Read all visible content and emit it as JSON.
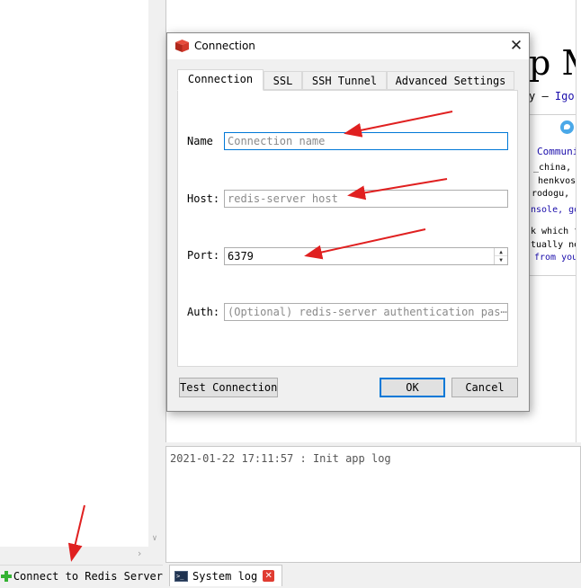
{
  "sidebar": {
    "connect_button_label": "Connect to Redis Server"
  },
  "welcome": {
    "title": "p M",
    "author_prefix": "y – ",
    "author_name": "Igor",
    "lines": [
      {
        "text": "Communi",
        "link": true
      },
      {
        "text": "_china, Gu",
        "link": false
      },
      {
        "text": "henkvos,",
        "link": false
      },
      {
        "text": "rodogu, p",
        "link": false
      },
      {
        "text": "nsole, goo",
        "link": true
      },
      {
        "text": "k which fe",
        "link": false
      },
      {
        "text": "tually nee",
        "link": false
      },
      {
        "text": "from your",
        "link": true
      }
    ]
  },
  "log": {
    "line": "2021-01-22 17:11:57 : Init app log",
    "tab_label": "System log"
  },
  "dialog": {
    "title": "Connection",
    "tabs": [
      {
        "label": "Connection",
        "active": true
      },
      {
        "label": "SSL",
        "active": false
      },
      {
        "label": "SSH Tunnel",
        "active": false
      },
      {
        "label": "Advanced Settings",
        "active": false
      }
    ],
    "fields": {
      "name": {
        "label": "Name",
        "value": "",
        "placeholder": "Connection name"
      },
      "host": {
        "label": "Host:",
        "value": "",
        "placeholder": "redis-server host"
      },
      "port": {
        "label": "Port:",
        "value": "6379"
      },
      "auth": {
        "label": "Auth:",
        "value": "",
        "placeholder": "(Optional) redis-server authentication pas⋯"
      }
    },
    "buttons": {
      "test": "Test Connection",
      "ok": "OK",
      "cancel": "Cancel"
    }
  },
  "colors": {
    "accent": "#0078d7",
    "annotation_arrow": "#e02020",
    "add_icon": "#34b233"
  }
}
